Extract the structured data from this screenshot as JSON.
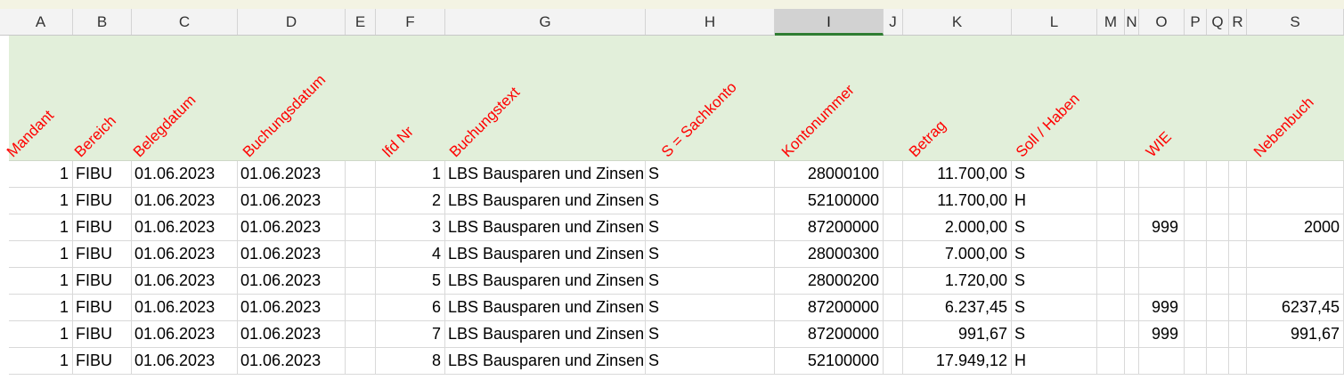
{
  "columns": [
    "A",
    "B",
    "C",
    "D",
    "E",
    "F",
    "G",
    "H",
    "I",
    "J",
    "K",
    "L",
    "M",
    "N",
    "O",
    "P",
    "Q",
    "R",
    "S"
  ],
  "active_column": "I",
  "headers": {
    "mandant": "Mandant",
    "bereich": "Bereich",
    "belegdatum": "Belegdatum",
    "buchungsdatum": "Buchungsdatum",
    "lfdnr": "lfd Nr",
    "buchungstext": "Buchungstext",
    "sachkonto": "S = Sachkonto",
    "kontonummer": "Kontonummer",
    "betrag": "Betrag",
    "sollhaben": "Soll / Haben",
    "wie": "WIE",
    "nebenbuch": "Nebenbuch"
  },
  "rows": [
    {
      "mandant": "1",
      "bereich": "FIBU",
      "belegdatum": "01.06.2023",
      "buchungsdatum": "01.06.2023",
      "lfdnr": "1",
      "buchungstext": "LBS Bausparen und Zinsen",
      "sachkonto": "S",
      "kontonummer": "28000100",
      "betrag": "11.700,00",
      "sollhaben": "S",
      "wie": "",
      "nebenbuch": ""
    },
    {
      "mandant": "1",
      "bereich": "FIBU",
      "belegdatum": "01.06.2023",
      "buchungsdatum": "01.06.2023",
      "lfdnr": "2",
      "buchungstext": "LBS Bausparen und Zinsen",
      "sachkonto": "S",
      "kontonummer": "52100000",
      "betrag": "11.700,00",
      "sollhaben": "H",
      "wie": "",
      "nebenbuch": ""
    },
    {
      "mandant": "1",
      "bereich": "FIBU",
      "belegdatum": "01.06.2023",
      "buchungsdatum": "01.06.2023",
      "lfdnr": "3",
      "buchungstext": "LBS Bausparen und Zinsen",
      "sachkonto": "S",
      "kontonummer": "87200000",
      "betrag": "2.000,00",
      "sollhaben": "S",
      "wie": "999",
      "nebenbuch": "2000"
    },
    {
      "mandant": "1",
      "bereich": "FIBU",
      "belegdatum": "01.06.2023",
      "buchungsdatum": "01.06.2023",
      "lfdnr": "4",
      "buchungstext": "LBS Bausparen und Zinsen",
      "sachkonto": "S",
      "kontonummer": "28000300",
      "betrag": "7.000,00",
      "sollhaben": "S",
      "wie": "",
      "nebenbuch": ""
    },
    {
      "mandant": "1",
      "bereich": "FIBU",
      "belegdatum": "01.06.2023",
      "buchungsdatum": "01.06.2023",
      "lfdnr": "5",
      "buchungstext": "LBS Bausparen und Zinsen",
      "sachkonto": "S",
      "kontonummer": "28000200",
      "betrag": "1.720,00",
      "sollhaben": "S",
      "wie": "",
      "nebenbuch": ""
    },
    {
      "mandant": "1",
      "bereich": "FIBU",
      "belegdatum": "01.06.2023",
      "buchungsdatum": "01.06.2023",
      "lfdnr": "6",
      "buchungstext": "LBS Bausparen und Zinsen",
      "sachkonto": "S",
      "kontonummer": "87200000",
      "betrag": "6.237,45",
      "sollhaben": "S",
      "wie": "999",
      "nebenbuch": "6237,45"
    },
    {
      "mandant": "1",
      "bereich": "FIBU",
      "belegdatum": "01.06.2023",
      "buchungsdatum": "01.06.2023",
      "lfdnr": "7",
      "buchungstext": "LBS Bausparen und Zinsen",
      "sachkonto": "S",
      "kontonummer": "87200000",
      "betrag": "991,67",
      "sollhaben": "S",
      "wie": "999",
      "nebenbuch": "991,67"
    },
    {
      "mandant": "1",
      "bereich": "FIBU",
      "belegdatum": "01.06.2023",
      "buchungsdatum": "01.06.2023",
      "lfdnr": "8",
      "buchungstext": "LBS Bausparen und Zinsen",
      "sachkonto": "S",
      "kontonummer": "52100000",
      "betrag": "17.949,12",
      "sollhaben": "H",
      "wie": "",
      "nebenbuch": ""
    }
  ]
}
